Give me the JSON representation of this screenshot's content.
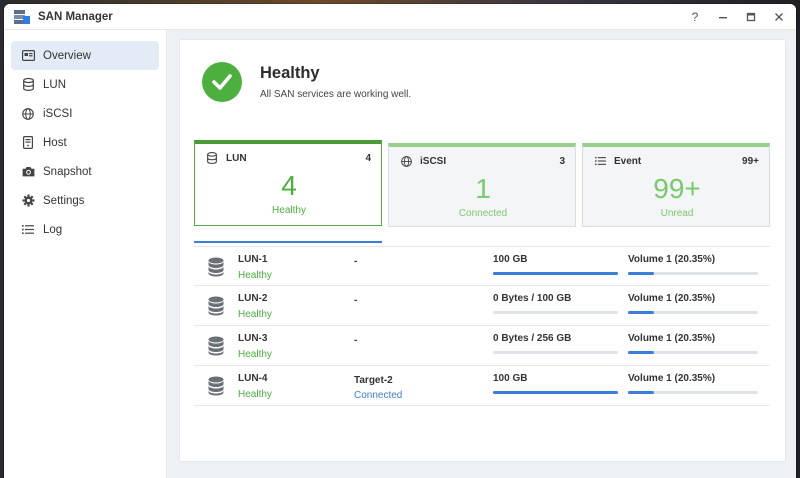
{
  "window": {
    "title": "SAN Manager",
    "controls": [
      "?",
      "minimize",
      "maximize",
      "close"
    ]
  },
  "sidebar": {
    "items": [
      {
        "label": "Overview",
        "icon": "overview-icon",
        "active": true
      },
      {
        "label": "LUN",
        "icon": "database-icon",
        "active": false
      },
      {
        "label": "iSCSI",
        "icon": "globe-icon",
        "active": false
      },
      {
        "label": "Host",
        "icon": "host-icon",
        "active": false
      },
      {
        "label": "Snapshot",
        "icon": "camera-icon",
        "active": false
      },
      {
        "label": "Settings",
        "icon": "gear-icon",
        "active": false
      },
      {
        "label": "Log",
        "icon": "list-icon",
        "active": false
      }
    ]
  },
  "status": {
    "title": "Healthy",
    "subtitle": "All SAN services are working well."
  },
  "cards": [
    {
      "title": "LUN",
      "count": "4",
      "big": "4",
      "sub": "Healthy",
      "icon": "database-icon",
      "active": true
    },
    {
      "title": "iSCSI",
      "count": "3",
      "big": "1",
      "sub": "Connected",
      "icon": "globe-icon",
      "active": false
    },
    {
      "title": "Event",
      "count": "99+",
      "big": "99+",
      "sub": "Unread",
      "icon": "list-icon",
      "active": false
    }
  ],
  "luns": [
    {
      "name": "LUN-1",
      "health": "Healthy",
      "target": "-",
      "target_status": "",
      "size": "100 GB",
      "size_fill": 1.0,
      "volume": "Volume 1 (20.35%)",
      "volume_fill": 0.2035
    },
    {
      "name": "LUN-2",
      "health": "Healthy",
      "target": "-",
      "target_status": "",
      "size": "0 Bytes / 100 GB",
      "size_fill": 0.0,
      "volume": "Volume 1 (20.35%)",
      "volume_fill": 0.2035
    },
    {
      "name": "LUN-3",
      "health": "Healthy",
      "target": "-",
      "target_status": "",
      "size": "0 Bytes / 256 GB",
      "size_fill": 0.0,
      "volume": "Volume 1 (20.35%)",
      "volume_fill": 0.2035
    },
    {
      "name": "LUN-4",
      "health": "Healthy",
      "target": "Target-2",
      "target_status": "Connected",
      "size": "100 GB",
      "size_fill": 1.0,
      "volume": "Volume 1 (20.35%)",
      "volume_fill": 0.2035
    }
  ],
  "colors": {
    "accent": "#3b7ed9",
    "healthy": "#4caf3f"
  }
}
